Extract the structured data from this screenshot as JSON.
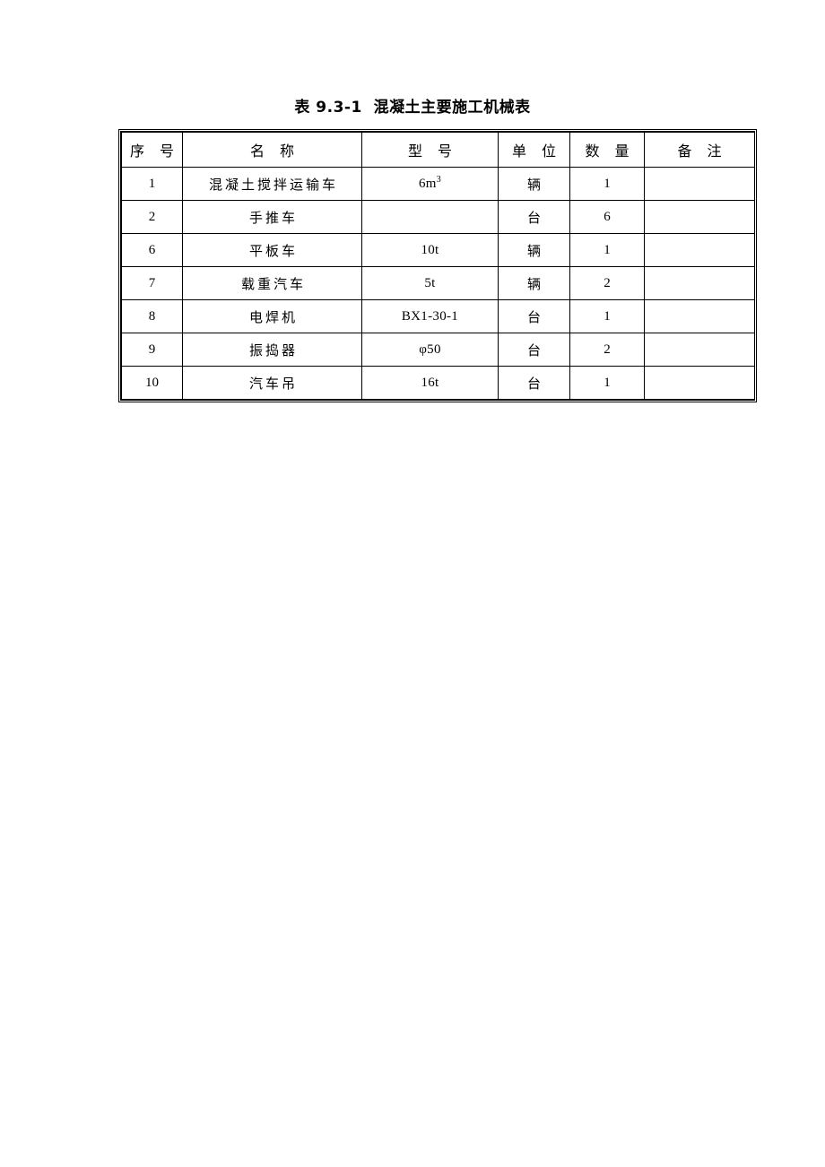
{
  "document": {
    "caption": "表 9.3-1  混凝土主要施工机械表"
  },
  "table": {
    "columns": [
      {
        "key": "seq",
        "label": "序 号"
      },
      {
        "key": "name",
        "label": "名     称"
      },
      {
        "key": "model",
        "label": "型     号"
      },
      {
        "key": "unit",
        "label": "单 位"
      },
      {
        "key": "qty",
        "label": "数 量"
      },
      {
        "key": "note",
        "label": "备 注"
      }
    ],
    "rows": [
      {
        "seq": "1",
        "name": "混凝土搅拌运输车",
        "model": "6m",
        "model_sup": "3",
        "unit": "辆",
        "qty": "1",
        "note": ""
      },
      {
        "seq": "2",
        "name": "手推车",
        "model": "",
        "model_sup": "",
        "unit": "台",
        "qty": "6",
        "note": ""
      },
      {
        "seq": "6",
        "name": "平板车",
        "model": "10t",
        "model_sup": "",
        "unit": "辆",
        "qty": "1",
        "note": ""
      },
      {
        "seq": "7",
        "name": "载重汽车",
        "model": "5t",
        "model_sup": "",
        "unit": "辆",
        "qty": "2",
        "note": ""
      },
      {
        "seq": "8",
        "name": "电焊机",
        "model": "BX1-30-1",
        "model_sup": "",
        "unit": "台",
        "qty": "1",
        "note": ""
      },
      {
        "seq": "9",
        "name": "振捣器",
        "model": "φ50",
        "model_sup": "",
        "unit": "台",
        "qty": "2",
        "note": ""
      },
      {
        "seq": "10",
        "name": "汽车吊",
        "model": "16t",
        "model_sup": "",
        "unit": "台",
        "qty": "1",
        "note": ""
      }
    ]
  },
  "colors": {
    "page_background": "#ffffff",
    "text": "#000000",
    "border": "#000000"
  }
}
